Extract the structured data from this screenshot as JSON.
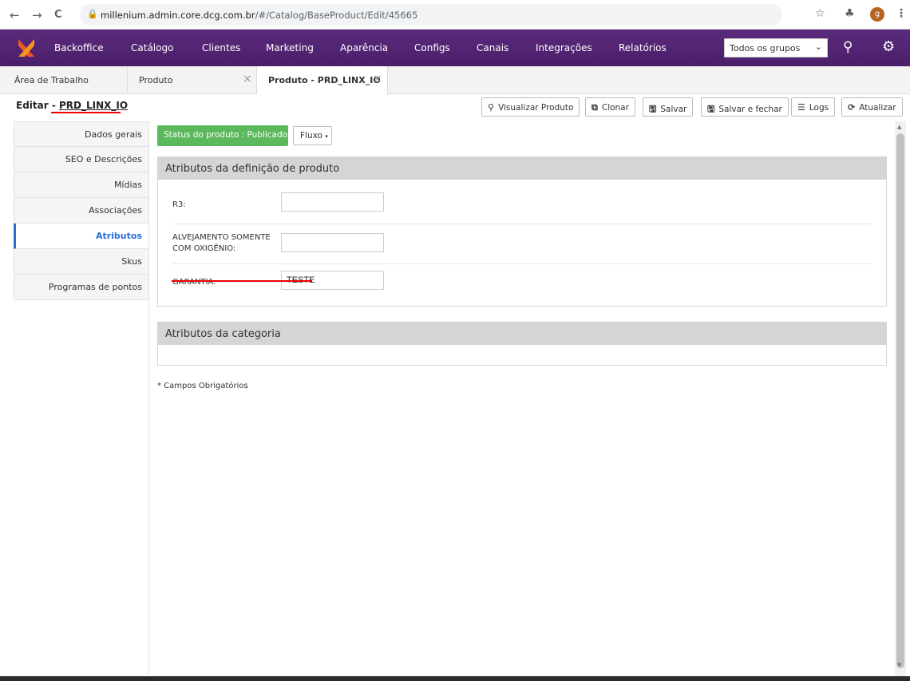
{
  "browser": {
    "back_icon": "←",
    "forward_icon": "→",
    "reload_icon": "C",
    "url_domain": "millenium.admin.core.dcg.com.br",
    "url_path": "/#/Catalog/BaseProduct/Edit/45665",
    "profile_initial": "g"
  },
  "topnav": {
    "items": [
      "Backoffice",
      "Catálogo",
      "Clientes",
      "Marketing",
      "Aparência",
      "Configs",
      "Canais",
      "Integrações",
      "Relatórios"
    ],
    "group_select": "Todos os grupos",
    "brand_color": "#4f2370"
  },
  "tabs": [
    {
      "label": "Área de Trabalho"
    },
    {
      "label": "Produto"
    },
    {
      "label": "Produto - PRD_LINX_IO"
    }
  ],
  "edit": {
    "prefix": "Editar - ",
    "code": "PRD_LINX_IO"
  },
  "toolbar": {
    "view": "Visualizar Produto",
    "clone": "Clonar",
    "save": "Salvar",
    "save_close": "Salvar e fechar",
    "logs": "Logs",
    "refresh": "Atualizar"
  },
  "sidebar": {
    "items": [
      "Dados gerais",
      "SEO e Descrições",
      "Mídias",
      "Associações",
      "Atributos",
      "Skus",
      "Programas de pontos"
    ],
    "active_index": 4
  },
  "status": {
    "label": "Status do produto : Publicado",
    "color": "#5cb85c",
    "flow_label": "Fluxo"
  },
  "product_attributes": {
    "title": "Atributos da definição de produto",
    "fields": [
      {
        "label": "R3:",
        "value": ""
      },
      {
        "label_line1": "ALVEJAMENTO SOMENTE",
        "label_line2": "COM OXIGÊNIO:",
        "value": ""
      },
      {
        "label": "GARANTIA:",
        "value": "TESTE"
      }
    ]
  },
  "category_attributes": {
    "title": "Atributos da categoria"
  },
  "footer_note": "* Campos Obrigatórios"
}
